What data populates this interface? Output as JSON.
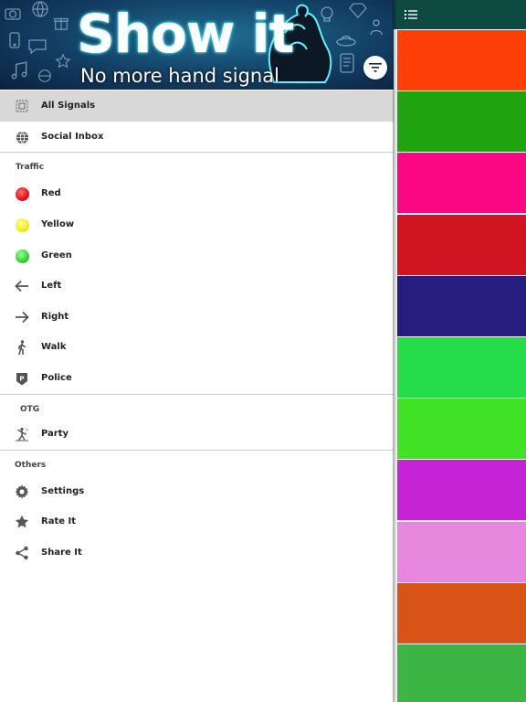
{
  "banner": {
    "title": "Show it",
    "subtitle": "No more hand signal"
  },
  "menu": {
    "all_signals": "All Signals",
    "social_inbox": "Social Inbox",
    "traffic_header": "Traffic",
    "traffic": [
      {
        "label": "Red",
        "color": "#e4111a"
      },
      {
        "label": "Yellow",
        "color": "#f3ee14"
      },
      {
        "label": "Green",
        "color": "#2fd432"
      },
      {
        "label": "Left",
        "icon": "arrow-left-icon"
      },
      {
        "label": "Right",
        "icon": "arrow-right-icon"
      },
      {
        "label": "Walk",
        "icon": "walk-icon"
      },
      {
        "label": "Police",
        "icon": "police-badge-icon"
      }
    ],
    "otg_header": "OTG",
    "party": "Party",
    "others_header": "Others",
    "settings": "Settings",
    "rate": "Rate It",
    "share": "Share It"
  },
  "colors": {
    "topbar": "#0f4a42",
    "active_row": "#d8d8d8",
    "swatches": [
      "#ff3f08",
      "#1fa30f",
      "#fb0683",
      "#d01521",
      "#251e80",
      "#25dc4b",
      "#41e225",
      "#c423d6",
      "#e686dc",
      "#d75316",
      "#3db544"
    ]
  }
}
